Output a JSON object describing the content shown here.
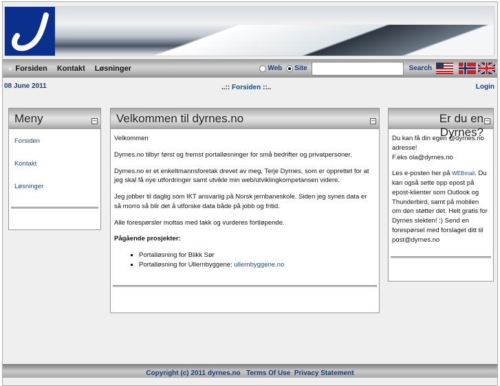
{
  "nav": {
    "items": [
      "Forsiden",
      "Kontakt",
      "Løsninger"
    ]
  },
  "search": {
    "options": [
      "Web",
      "Site"
    ],
    "selected": "Site",
    "value": "",
    "button": "Search"
  },
  "languages": [
    "english-us",
    "norsk",
    "english-uk"
  ],
  "dateline": {
    "date": "08 June 2011",
    "breadcrumb_pre": "..::",
    "breadcrumb": "Forsiden",
    "breadcrumb_post": "::..",
    "login": "Login"
  },
  "menu": {
    "title": "Meny",
    "items": [
      "Forsiden",
      "Kontakt",
      "Løsninger"
    ]
  },
  "main": {
    "title": "Velkommen til dyrnes.no",
    "paragraphs": [
      "Velkommen",
      "Dyrnes.no tilbyr først og fremst portalløsninger for små bedrifter og privatpersoner.",
      "Dyrnes.no er et enkeltmannsforetak drevet av meg, Terje Dyrnes, som er opprettet for at jeg skal få nye utfordringer samt utvikle min web/utviklingkompetansen videre.",
      "Jeg jobber til daglig som IKT ansvarlig på Norsk jernbaneskole. Siden jeg synes data er så morro så blir det å utforske data både på jobb og fritid.",
      "Alle forespørsler mottas med takk og vurderes fortløpende."
    ],
    "projects_heading": "Pågående prosjekter:",
    "projects": [
      "Portalløsning for Blikk Sør",
      "Portalløsning for Ullernbyggene: "
    ],
    "project_link": "ullernbyggene.no"
  },
  "side": {
    "title": "Er du en Dyrnes?",
    "p1": "Du kan få din egen @dyrnes.no adresse!",
    "p1b": "F.eks ola@dyrnes.no",
    "p2a": "Les e-posten her på ",
    "webmail": "WEBmail",
    "p2b": ". Du kan også sette opp epost på epost-klienter som Outlook og Thunderbird, samt på mobilen om den støtter det. Helt gratis for Dyrnes slekten! :) Send en forespørsel med forslaget ditt til post@dyrnes.no"
  },
  "footer": {
    "copyright": "Copyright (c) 2011 dyrnes.no",
    "terms": "Terms Of Use",
    "privacy": "Privacy Statement"
  }
}
